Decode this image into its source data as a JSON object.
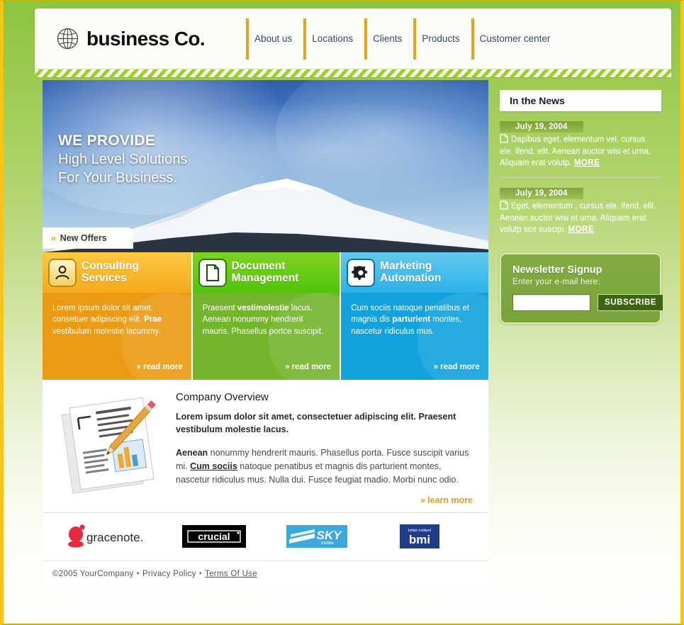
{
  "header": {
    "brand": "business Co.",
    "logo_icon": "globe-icon",
    "nav": [
      {
        "label": "About us"
      },
      {
        "label": "Locations"
      },
      {
        "label": "Clients"
      },
      {
        "label": "Products"
      },
      {
        "label": "Customer center"
      }
    ]
  },
  "hero": {
    "line1": "WE PROVIDE",
    "line2": "High Level Solutions",
    "line3": "For Your Business.",
    "offers_tab": "New Offers",
    "offers_chevron": "»"
  },
  "services": [
    {
      "title_line1": "Consulting",
      "title_line2": "Services",
      "icon": "user-icon",
      "body_pre": "Lorem ipsum dolor sit amet, consetuer adipiscing elit. ",
      "body_bold": "Prae",
      "body_post": " vestibulum molestie lacummy.",
      "read_more": "read more",
      "accent": "#eb9a13"
    },
    {
      "title_line1": "Document",
      "title_line2": "Management",
      "icon": "document-icon",
      "body_pre": "Praesent ",
      "body_bold": "vestimolestie",
      "body_post": " lacus. Aenean nonummy hendrerit mauris. Phasellus portce suscipit.",
      "read_more": "read more",
      "accent": "#73b52b"
    },
    {
      "title_line1": "Marketing",
      "title_line2": "Automation",
      "icon": "gear-icon",
      "body_pre": "Cum sociis natoque penatibus et magnis dis ",
      "body_bold": "parturient",
      "body_post": " montes, nascetur ridiculus mus.",
      "read_more": "read more",
      "accent": "#12a2dd"
    }
  ],
  "overview": {
    "title": "Company Overview",
    "illustration": "documents-pencil-chart-illustration",
    "lead": "Lorem ipsum dolor sit amet, consectetuer adipiscing elit. Praesent vestibulum molestie lacus.",
    "body_bold": "Aenean",
    "body_part1": " nonummy hendrerit mauris. Phasellus porta. Fusce suscipit varius mi. ",
    "body_link": "Cum sociis",
    "body_part2": " natoque penatibus et magnis dis parturient montes, nascetur ridiculus mus. Nulla dui. Fusce feugiat madio. Morbi nunc odio.",
    "learn_more": "learn more",
    "chevron": "»"
  },
  "partners": [
    {
      "name": "gracenote"
    },
    {
      "name": "crucial"
    },
    {
      "name": "SKY"
    },
    {
      "name": "bmi"
    }
  ],
  "footer": {
    "copyright": "©2005 YourCompany",
    "bullet": "•",
    "privacy": "Privacy Policy",
    "terms": "Terms Of Use"
  },
  "sidebar": {
    "news_title": "In the News",
    "news": [
      {
        "date": "July 19, 2004",
        "text": "Dapibus eget, elementum vel, cursus ele. ifend, elit. Aenean auctor wisi et urna. Aliquam erat volutp.",
        "more": "MORE"
      },
      {
        "date": "July 19, 2004",
        "text": "Eget, elementum , cursus ele. ifend, elit. Aenean auctor wisi et urna. Aliquam erat volutp sce suscipi.",
        "more": "MORE"
      }
    ],
    "newsletter": {
      "title": "Newsletter Signup",
      "subtitle": "Enter your e-mail here:",
      "input_value": "",
      "input_placeholder": "",
      "button": "SUBSCRIBE"
    }
  },
  "colors": {
    "page_green": "#8cc63e",
    "border_gold": "#f5c518",
    "nav_accent": "#e8a317",
    "orange": "#eb9a13",
    "green": "#73b52b",
    "blue": "#12a2dd",
    "newsletter_green": "#7aa33b"
  }
}
